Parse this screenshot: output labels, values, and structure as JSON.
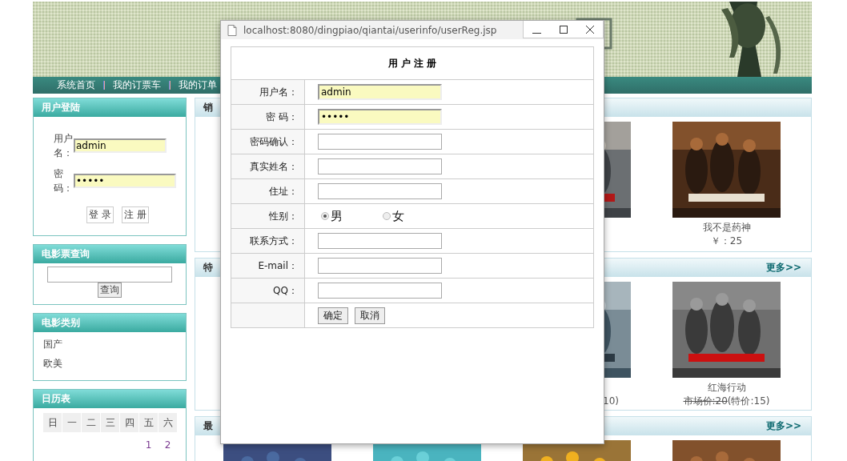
{
  "header": {
    "nav": [
      "系统首页",
      "我的订票车",
      "我的订单"
    ]
  },
  "login": {
    "title": "用户登陆",
    "fields": [
      {
        "label": "用户名：",
        "value": "admin"
      },
      {
        "label": "密码：",
        "value": "•••••"
      }
    ],
    "buttons": [
      "登 录",
      "注 册"
    ]
  },
  "ticket_search": {
    "title": "电影票查询",
    "button": "查询"
  },
  "categories": {
    "title": "电影类别",
    "items": [
      "国产",
      "欧美"
    ]
  },
  "calendar": {
    "title": "日历表",
    "weekdays": [
      "日",
      "一",
      "二",
      "三",
      "四",
      "五",
      "六"
    ],
    "first_week": [
      "1",
      "2"
    ]
  },
  "sections": [
    {
      "title": "销",
      "cards": [
        {
          "kind": "partial"
        },
        {
          "kind": "full",
          "title": "我不是药神",
          "price": "￥：25"
        }
      ]
    },
    {
      "title": "特",
      "more": "更多>>",
      "cards": [
        {
          "kind": "partial",
          "caption": "10)"
        },
        {
          "kind": "special",
          "title": "红海行动",
          "market_price": "市场价:20",
          "special_price": "(特价:15)"
        }
      ]
    },
    {
      "title": "最",
      "more": "更多>>",
      "cards": [
        {
          "kind": "poster"
        },
        {
          "kind": "poster"
        },
        {
          "kind": "poster"
        },
        {
          "kind": "poster"
        }
      ]
    }
  ],
  "popup": {
    "url": "localhost:8080/dingpiao/qiantai/userinfo/userReg.jsp",
    "form": {
      "title": "用 户 注 册",
      "rows": [
        {
          "kind": "input",
          "label": "用户名：",
          "value": "admin"
        },
        {
          "kind": "input",
          "label": "密 码：",
          "value": "•••••"
        },
        {
          "kind": "input",
          "label": "密码确认："
        },
        {
          "kind": "input",
          "label": "真实姓名："
        },
        {
          "kind": "input",
          "label": "住址："
        },
        {
          "kind": "radio",
          "label": "性别：",
          "options": [
            {
              "label": "男",
              "selected": true
            },
            {
              "label": "女",
              "selected": false
            }
          ]
        },
        {
          "kind": "input",
          "label": "联系方式："
        },
        {
          "kind": "input",
          "label": "E-mail："
        },
        {
          "kind": "input",
          "label": "QQ："
        }
      ],
      "buttons": [
        "确定",
        "取消"
      ]
    }
  }
}
